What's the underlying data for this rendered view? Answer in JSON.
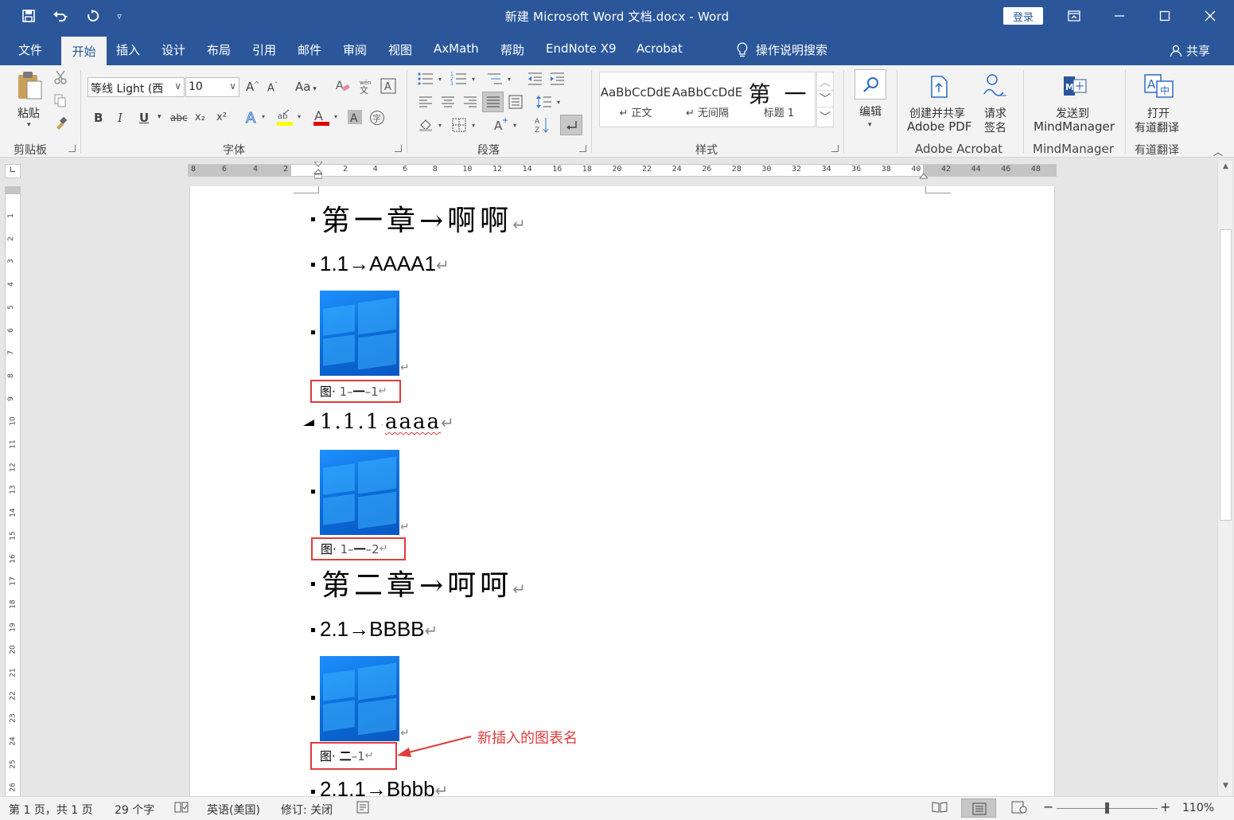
{
  "title_bar": {
    "title": "新建 Microsoft Word 文档.docx  -  Word",
    "login": "登录"
  },
  "tabs": [
    "文件",
    "开始",
    "插入",
    "设计",
    "布局",
    "引用",
    "邮件",
    "审阅",
    "视图",
    "AxMath",
    "帮助",
    "EndNote X9",
    "Acrobat"
  ],
  "tell_me": "操作说明搜索",
  "share": "共享",
  "ribbon": {
    "clipboard": {
      "paste": "粘贴",
      "label": "剪贴板"
    },
    "font": {
      "name": "等线 Light (西",
      "size": "10",
      "label": "字体",
      "change_case": "Aa",
      "bold": "B",
      "italic": "I",
      "underline": "U",
      "strike": "abc",
      "sub": "x₂",
      "sup": "x²"
    },
    "paragraph": {
      "label": "段落"
    },
    "styles": {
      "label": "样式",
      "items": [
        {
          "preview": "AaBbCcDdE",
          "name": "↵ 正文"
        },
        {
          "preview": "AaBbCcDdE",
          "name": "↵ 无间隔"
        },
        {
          "preview": "第 一",
          "name": "标题 1"
        }
      ]
    },
    "editing": {
      "label": "编辑"
    },
    "acrobat": {
      "create_line1": "创建并共享",
      "create_line2": "Adobe PDF",
      "sign_line1": "请求",
      "sign_line2": "签名",
      "label": "Adobe Acrobat"
    },
    "mindmanager": {
      "send_line1": "发送到",
      "send_line2": "MindManager",
      "label": "MindManager"
    },
    "youdao": {
      "open_line1": "打开",
      "open_line2": "有道翻译",
      "label": "有道翻译"
    }
  },
  "ruler": {
    "left_ticks": [
      "8",
      "6",
      "4",
      "2"
    ],
    "right_ticks": [
      "2",
      "4",
      "6",
      "8",
      "10",
      "12",
      "14",
      "16",
      "18",
      "20",
      "22",
      "24",
      "26",
      "28",
      "30",
      "32",
      "34",
      "36",
      "38",
      "40",
      "42",
      "44",
      "46",
      "48"
    ],
    "vertical_ticks": [
      "1",
      "2",
      "3",
      "4",
      "5",
      "6",
      "7",
      "8",
      "9",
      "10",
      "11",
      "12",
      "13",
      "14",
      "15",
      "16",
      "17",
      "18",
      "19",
      "20",
      "21",
      "22",
      "23",
      "24",
      "25",
      "26"
    ]
  },
  "document": {
    "heading1_a": "第一章→啊啊",
    "heading2_a": "1.1→AAAA1",
    "caption_1": {
      "prefix": "图·",
      "chapter": "1–",
      "num": "一",
      "tail": "–1"
    },
    "heading3_a_num": "1.1.1",
    "heading3_a_text": "aaaa",
    "caption_2": {
      "prefix": "图·",
      "chapter": "1–",
      "num": "一",
      "tail": "–2"
    },
    "heading1_b": "第二章→呵呵",
    "heading2_b": "2.1→BBBB",
    "caption_3": {
      "prefix": "图·",
      "num": "二",
      "tail": "–1"
    },
    "heading3_b": "2.1.1→Bbbb",
    "return_mark": "↵"
  },
  "annotation": "新插入的图表名",
  "status_bar": {
    "page": "第 1 页，共 1 页",
    "words": "29 个字",
    "language": "英语(美国)",
    "track_changes": "修订: 关闭",
    "zoom": "110%"
  },
  "colors": {
    "accent": "#2b579a",
    "highlight_box": "#e03c3c",
    "image_blue": "#1e90ff"
  }
}
